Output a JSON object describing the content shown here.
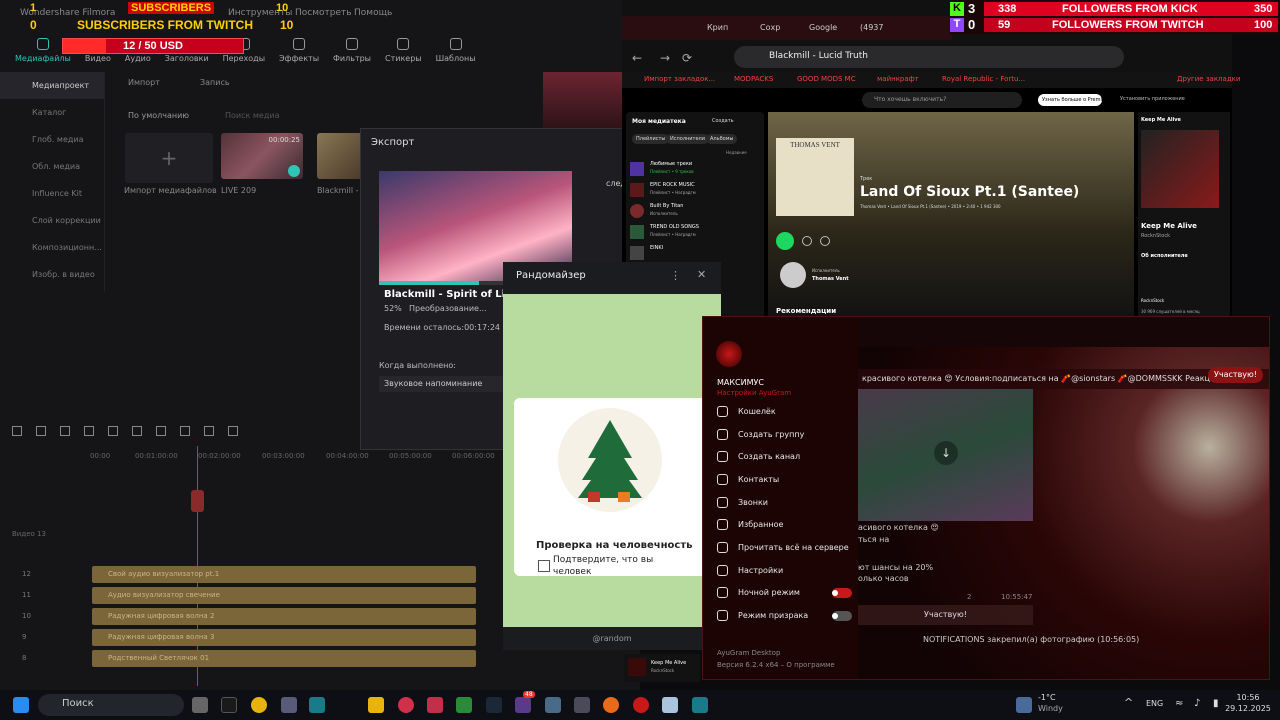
{
  "overlay_left": {
    "row1_num": "1",
    "row1_label": "SUBSCRIBERS",
    "row1_val": "10",
    "row2_num": "0",
    "row2_label": "SUBSCRIBERS FROM TWITCH",
    "row2_val": "10",
    "goal": "12 / 50 USD",
    "goal_fill": 0.24
  },
  "overlay_right": {
    "kick_count": "3",
    "twitch_count": "0",
    "kick_cur": "338",
    "kick_label": "FOLLOWERS FROM KICK",
    "kick_goal": "350",
    "twitch_cur": "59",
    "twitch_label": "FOLLOWERS FROM TWITCH",
    "twitch_goal": "100"
  },
  "filmora": {
    "menu": [
      "Wondershare Filmora",
      "Инструменты",
      "Посмотреть",
      "Помощь"
    ],
    "tabs": [
      "Медиафайлы",
      "Видео",
      "Аудио",
      "Заголовки",
      "Переходы",
      "Эффекты",
      "Фильтры",
      "Стикеры",
      "Шаблоны"
    ],
    "side": [
      "Медиапроект",
      "Каталог",
      "Глоб. медиа",
      "Обл. медиа",
      "Influence Kit",
      "Слой коррекции",
      "Композиционн...",
      "Изобр. в видео"
    ],
    "import_btn": "Импорт",
    "record_btn": "Запись",
    "sort": "По умолчанию",
    "search_placeholder": "Поиск медиа",
    "import_media": "Импорт медиафайлов",
    "clip1_name": "LIVE 209",
    "clip1_dur": "00:00:25",
    "clip2_name": "Blackmill - S",
    "ruler": [
      "00:00",
      "00:01:00:00",
      "00:02:00:00",
      "00:03:00:00",
      "00:04:00:00",
      "00:05:00:00",
      "00:06:00:00"
    ],
    "tracks": [
      {
        "n": "12",
        "label": "Свой аудио визуализатор pt.1"
      },
      {
        "n": "11",
        "label": "Аудио визуализатор свечение"
      },
      {
        "n": "10",
        "label": "Радужная цифровая волна 2"
      },
      {
        "n": "9",
        "label": "Радужная цифровая волна 3"
      },
      {
        "n": "8",
        "label": "Родственный Светлячок 01"
      }
    ],
    "video_track": "Видео 13"
  },
  "export": {
    "title": "Экспорт",
    "file": "Blackmill - Spirit of Life.m",
    "percent": "52%",
    "status": "Преобразование...",
    "progress": 0.52,
    "time_left": "Времени осталось:00:17:24",
    "when_done": "Когда выполнено:",
    "option": "Звуковое напоминание",
    "side_text": "след"
  },
  "randomizer": {
    "title": "Рандомайзер",
    "check_title": "Проверка на человечность",
    "check_text": "Подтвердите, что вы человек",
    "footer": "@random"
  },
  "browser": {
    "tabs": [
      "Крип",
      "Сохр",
      "Google",
      "(4937"
    ],
    "title": "Blackmill - Lucid Truth",
    "bookmarks": [
      "Импорт закладок...",
      "MODPACKS",
      "GOOD MODS MC",
      "майнкрафт",
      "Royal Republic - Fortu..."
    ],
    "bookmarks_right": "Другие закладки",
    "spotify": {
      "search": "Что хочешь включить?",
      "premium": "Узнать больше о Premium",
      "install": "Установить приложение",
      "library": "Моя медиатека",
      "create": "Создать",
      "filters": [
        "Плейлисты",
        "Исполнители",
        "Альбомы"
      ],
      "recent": "Недавние",
      "items": [
        {
          "t": "Любимые треки",
          "s": "Плейлист • 9 треков"
        },
        {
          "t": "EPIC ROCK MUSIC",
          "s": "Плейлист • Наградгм"
        },
        {
          "t": "Built By Titan",
          "s": "Исполнитель"
        },
        {
          "t": "TREND OLD SONGS",
          "s": "Плейлист • Наградгм"
        },
        {
          "t": "EINKI",
          "s": ""
        }
      ],
      "track_type": "Трек",
      "track_title": "Land Of Sioux Pt.1 (Santee)",
      "track_meta": "Thomas Vent • Land Of Sioux Pt.1 (Santee) • 2019 • 2:40 • 1 942 300",
      "cover_text": "THOMAS VENT",
      "artist_label": "Исполнитель",
      "artist": "Thomas Vent",
      "recs": "Рекомендации",
      "right_header": "Keep Me Alive",
      "right_title": "Keep Me Alive",
      "right_artist": "RocknStock",
      "about": "Об исполнителе",
      "listeners": "30 969 слушателей в месяц",
      "mini_title": "Keep Me Alive",
      "mini_artist": "RocknStock"
    }
  },
  "telegram": {
    "user": "МАКСИМУС",
    "status": "Настройки AyuGram",
    "menu": [
      "Кошелёк",
      "Создать группу",
      "Создать канал",
      "Контакты",
      "Звонки",
      "Избранное",
      "Прочитать всё на сервере",
      "Настройки",
      "Ночной режим",
      "Режим призрака"
    ],
    "app": "AyuGram Desktop",
    "version": "Версия 6.2.4 x64 – О программе",
    "banner": "красивого котелка 😍 Условия:подписаться на 🧨@sionstars 🧨@DOMMSSKK Реакции пов...",
    "participate": "Участвую!",
    "msg1": "асивого котелка 😍",
    "msg2": "ться на",
    "msg3": "ют шансы на 20%",
    "msg4": "олько часов",
    "views": "2",
    "msg_time": "10:55:47",
    "join": "Участвую!",
    "notif": "NOTIFICATIONS закрепил(а) фотографию (10:56:05)"
  },
  "taskbar": {
    "search": "Поиск",
    "weather_temp": "-1°C",
    "weather": "Windy",
    "lang": "ENG",
    "time": "10:56",
    "date": "29.12.2025",
    "badge": "48"
  }
}
